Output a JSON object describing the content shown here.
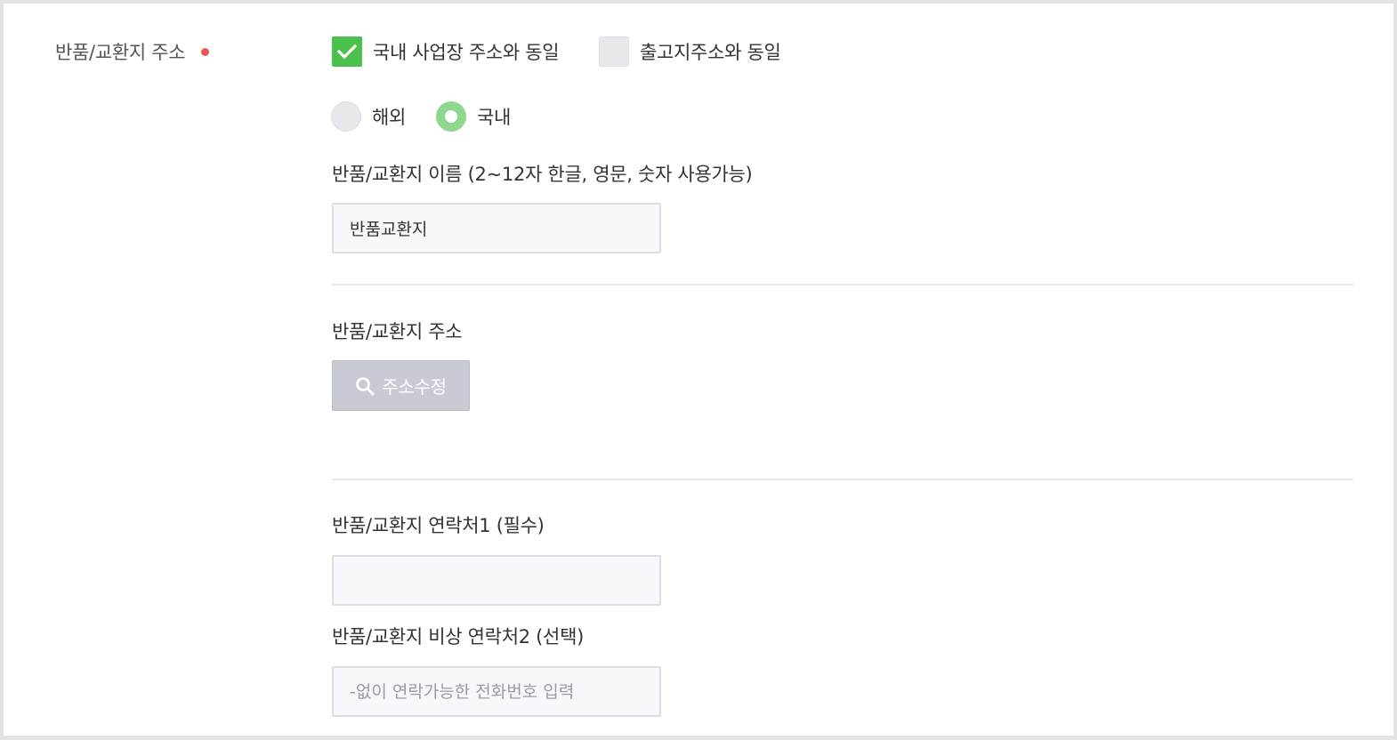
{
  "section": {
    "label": "반품/교환지 주소",
    "required_color": "#e85757"
  },
  "address_source": {
    "same_as_business": {
      "label": "국내 사업장 주소와 동일",
      "checked": true
    },
    "same_as_shipping": {
      "label": "출고지주소와 동일",
      "checked": false
    }
  },
  "region": {
    "options": [
      {
        "label": "해외",
        "selected": false
      },
      {
        "label": "국내",
        "selected": true
      }
    ]
  },
  "name_field": {
    "label": "반품/교환지 이름 (2~12자 한글, 영문, 숫자 사용가능)",
    "value": "반품교환지"
  },
  "address_field": {
    "label": "반품/교환지 주소",
    "edit_button": "주소수정"
  },
  "contact1_field": {
    "label": "반품/교환지 연락처1 (필수)",
    "value": ""
  },
  "contact2_field": {
    "label": "반품/교환지 비상 연락처2 (선택)",
    "placeholder": "-없이 연락가능한 전화번호 입력"
  },
  "colors": {
    "check_on": "#4cc04c",
    "radio_on": "#8fd68f",
    "button_bg": "#c8cbd3",
    "input_bg": "#f7f8fc"
  }
}
